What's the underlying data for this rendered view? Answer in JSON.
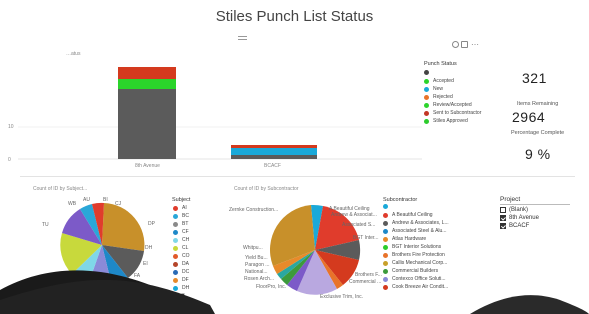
{
  "page": {
    "title": "Stiles Punch List Status"
  },
  "status_chart": {
    "title": "…atus",
    "y_ticks": [
      "10",
      "0"
    ],
    "legend_title": "Punch Status",
    "legend": [
      {
        "label": "",
        "color": "#444444"
      },
      {
        "label": "Accepted",
        "color": "#2bd42b"
      },
      {
        "label": "New",
        "color": "#1aa9d9"
      },
      {
        "label": "Rejected",
        "color": "#e8732a"
      },
      {
        "label": "Review/Accepted",
        "color": "#2dd42d"
      },
      {
        "label": "Sent to Subcontractor",
        "color": "#c33826"
      },
      {
        "label": "Stiles Approved",
        "color": "#2ccc2c"
      }
    ],
    "colors": {
      "gray": "#5b5b5b",
      "green": "#2bd42b",
      "red": "#d43a1e",
      "blue": "#1aa9d9"
    },
    "categories": [
      "8th Avenue",
      "BCACF"
    ]
  },
  "kpis": {
    "top_value": "321",
    "items_remaining_label": "Items Remaining",
    "items_remaining_value": "2964",
    "percentage_label": "Percentage Complete",
    "percentage_value": "9 %"
  },
  "subject_chart": {
    "title": "Count of ID by Subject...",
    "labels": [
      "WB",
      "AU",
      "BI",
      "CJ",
      "DP",
      "TU",
      "DH",
      "EI",
      "FA",
      "DC"
    ],
    "legend_title": "Subject",
    "legend": [
      {
        "label": "AI",
        "color": "#e03c2c"
      },
      {
        "label": "BC",
        "color": "#2aa7d8"
      },
      {
        "label": "BT",
        "color": "#8a8a8a"
      },
      {
        "label": "CF",
        "color": "#1e88c8"
      },
      {
        "label": "CH",
        "color": "#7fd7e8"
      },
      {
        "label": "CL",
        "color": "#c8d93c"
      },
      {
        "label": "CO",
        "color": "#e25a2a"
      },
      {
        "label": "DA",
        "color": "#b5452a"
      },
      {
        "label": "DC",
        "color": "#2a6ab5"
      },
      {
        "label": "DF",
        "color": "#e88a2a"
      },
      {
        "label": "DH",
        "color": "#1aa9d9"
      }
    ]
  },
  "sub_chart": {
    "title": "Count of ID by Subcontractor",
    "labels": [
      "A Beautiful Ceiling",
      "Andrew & Associat...",
      "Associated S...",
      "BGT Inter...",
      "Zernke Construction...",
      "Whitpu...",
      "Yield Bu...",
      "Paragon ...",
      "National...",
      "Rosen Arch...",
      "FloorPro, Inc.",
      "Brothers F...",
      "Commercial ...",
      "Exclusive Trim, Inc."
    ],
    "legend_title": "Subcontractor",
    "legend": [
      {
        "label": "",
        "color": "#1aa9d9"
      },
      {
        "label": "A Beautiful Ceiling",
        "color": "#e03c2c"
      },
      {
        "label": "Andrew & Associates, L...",
        "color": "#5b5b5b"
      },
      {
        "label": "Associated Steel & Alu...",
        "color": "#1e88c8"
      },
      {
        "label": "Atlas Hardware",
        "color": "#e88a2a"
      },
      {
        "label": "BGT Interior Solutions",
        "color": "#2ccc2c"
      },
      {
        "label": "Brothers Fire Protection",
        "color": "#e8732a"
      },
      {
        "label": "Callis Mechanical Corp...",
        "color": "#c8a02a"
      },
      {
        "label": "Commercial Builders",
        "color": "#3c9a3c"
      },
      {
        "label": "Contexco Office Soluti...",
        "color": "#8a8ad8"
      },
      {
        "label": "Cook Breeze Air Condit...",
        "color": "#d43a1e"
      }
    ]
  },
  "project_slicer": {
    "title": "Project",
    "items": [
      {
        "label": "(Blank)",
        "checked": false
      },
      {
        "label": "8th Avenue",
        "checked": true
      },
      {
        "label": "BCACF",
        "checked": true
      }
    ]
  }
}
